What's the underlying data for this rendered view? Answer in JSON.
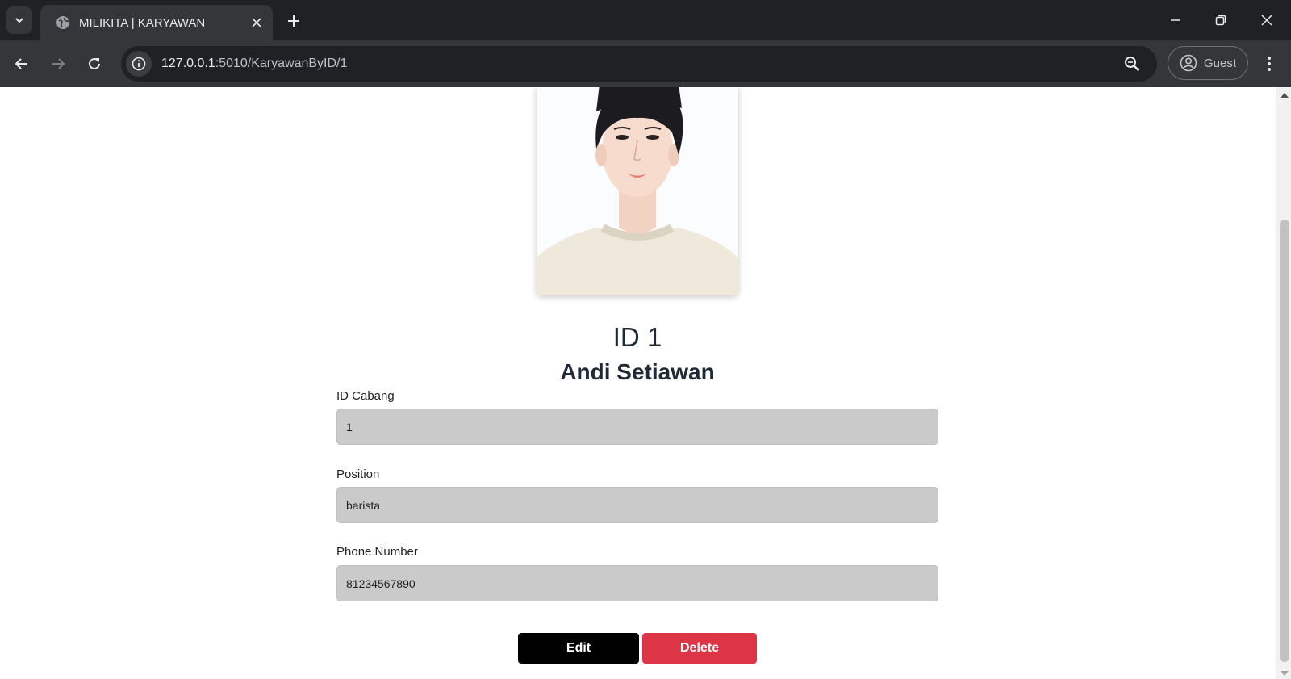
{
  "browser": {
    "tab_title": "MILIKITA | KARYAWAN",
    "url_host": "127.0.0.1",
    "url_rest": ":5010/KaryawanByID/1",
    "profile_label": "Guest"
  },
  "employee": {
    "id_label": "ID 1",
    "name": "Andi Setiawan",
    "fields": [
      {
        "label": "ID Cabang",
        "value": "1"
      },
      {
        "label": "Position",
        "value": "barista"
      },
      {
        "label": "Phone Number",
        "value": "81234567890"
      }
    ]
  },
  "actions": {
    "edit_label": "Edit",
    "delete_label": "Delete"
  },
  "colors": {
    "edit_button": "#000000",
    "delete_button": "#dc3545",
    "field_background": "#cacaca"
  }
}
